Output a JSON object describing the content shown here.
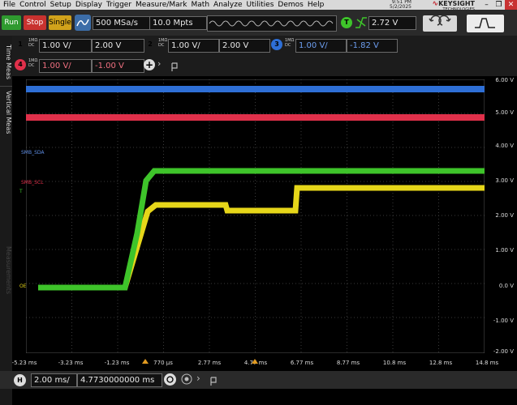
{
  "menu": [
    "File",
    "Control",
    "Setup",
    "Display",
    "Trigger",
    "Measure/Mark",
    "Math",
    "Analyze",
    "Utilities",
    "Demos",
    "Help"
  ],
  "datestamp": {
    "time": "9:51 PM",
    "date": "5/2/2025"
  },
  "brand": {
    "name": "KEYSIGHT",
    "sub": "TECHNOLOGIES"
  },
  "toolbar": {
    "run": "Run",
    "stop": "Stop",
    "single": "Single",
    "sample_rate": "500 MSa/s",
    "memory_depth": "10.0 Mpts",
    "trigger_badge": "T",
    "trigger_level": "2.72 V"
  },
  "channels": {
    "ch1": {
      "num": "1",
      "coupling": "1MΩ",
      "dc": "DC",
      "scale": "1.00 V/",
      "offset": "2.00 V",
      "color": "#e6d619"
    },
    "ch2": {
      "num": "2",
      "coupling": "1MΩ",
      "dc": "DC",
      "scale": "1.00 V/",
      "offset": "2.00 V",
      "color": "#3ec42a"
    },
    "ch3": {
      "num": "3",
      "coupling": "1MΩ",
      "dc": "DC",
      "scale": "1.00 V/",
      "offset": "-1.82 V",
      "color": "#2e6fd6"
    },
    "ch4": {
      "num": "4",
      "coupling": "1MΩ",
      "dc": "DC",
      "scale": "1.00 V/",
      "offset": "-1.00 V",
      "color": "#e0304a"
    }
  },
  "side_tabs": {
    "time_meas": "Time Meas",
    "vertical_meas": "Vertical Meas",
    "measurements": "Measurements"
  },
  "y_axis": [
    "6.00 V",
    "5.00 V",
    "4.00 V",
    "3.00 V",
    "2.00 V",
    "1.00 V",
    "0.0 V",
    "-1.00 V",
    "-2.00 V"
  ],
  "x_axis": [
    "-5.23 ms",
    "-3.23 ms",
    "-1.23 ms",
    "770 µs",
    "2.77 ms",
    "4.77 ms",
    "6.77 ms",
    "8.77 ms",
    "10.8 ms",
    "12.8 ms",
    "14.8 ms"
  ],
  "trace_labels": {
    "smb_sda": "SMB_SDA",
    "smb_scl": "SMB_SCL",
    "oe": "OE"
  },
  "timebase": {
    "badge": "H",
    "scale": "2.00 ms/",
    "position": "4.7730000000 ms"
  },
  "colors": {
    "ch1": "#e6d619",
    "ch2": "#3ec42a",
    "ch3": "#2e6fd6",
    "ch4": "#e0304a",
    "grid": "#3a3a3a"
  }
}
